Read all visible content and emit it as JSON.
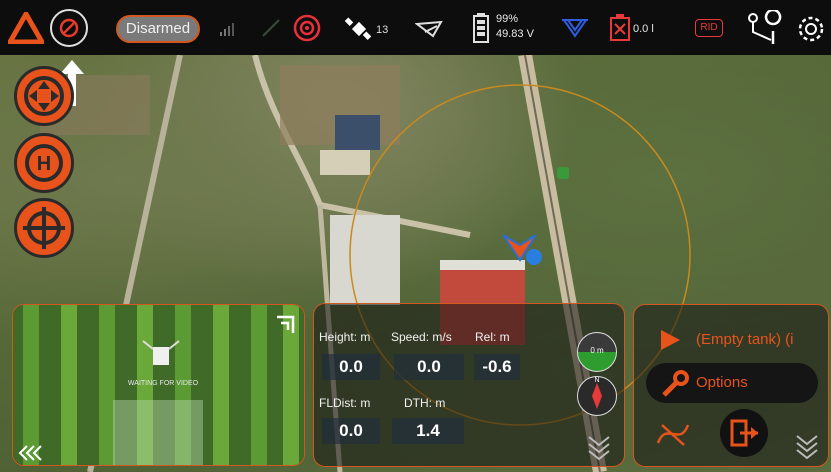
{
  "status": {
    "armed_label": "Disarmed"
  },
  "telemetry": {
    "satellites": "13",
    "battery_percent": "99%",
    "battery_voltage": "49.83 V",
    "tank_value": "0.0 l",
    "rid_label": "RID"
  },
  "flight": {
    "height_label": "Height: m",
    "speed_label": "Speed: m/s",
    "rel_label": "Rel: m",
    "height_value": "0.0",
    "speed_value": "0.0",
    "rel_value": "-0.6",
    "fldist_label": "FLDist: m",
    "dth_label": "DTH: m",
    "fldist_value": "0.0",
    "dth_value": "1.4"
  },
  "gauges": {
    "altitude_gauge_value": "0 m",
    "compass_label": "N"
  },
  "video": {
    "status_text": "WAITING FOR VIDEO"
  },
  "mission": {
    "play_label": "(Empty tank) (i",
    "options_label": "Options"
  },
  "colors": {
    "accent": "#e8531c",
    "panel_border": "#d2581f",
    "gauge_green": "#2e9c2e"
  }
}
